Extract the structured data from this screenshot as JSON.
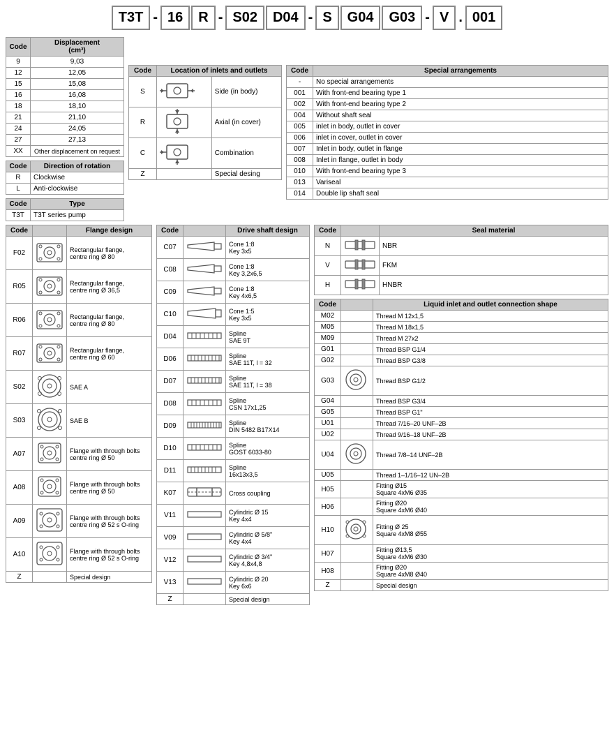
{
  "header": {
    "segments": [
      "T3T",
      "16",
      "R",
      "S02",
      "D04",
      "S",
      "G04",
      "G03",
      "V",
      "001"
    ],
    "dashes": [
      "-",
      "-",
      "-",
      "",
      "-",
      "",
      "",
      "-",
      ".",
      ""
    ],
    "display": "T3T - 16 R - S02 D04 - S G04 G03 - V . 001"
  },
  "displacement_table": {
    "title": "Displacement (cm³)",
    "col1": "Code",
    "col2": "Displacement (cm³)",
    "rows": [
      {
        "code": "9",
        "value": "9,03"
      },
      {
        "code": "12",
        "value": "12,05"
      },
      {
        "code": "15",
        "value": "15,08"
      },
      {
        "code": "16",
        "value": "16,08"
      },
      {
        "code": "18",
        "value": "18,10"
      },
      {
        "code": "21",
        "value": "21,10"
      },
      {
        "code": "24",
        "value": "24,05"
      },
      {
        "code": "27",
        "value": "27,13"
      },
      {
        "code": "XX",
        "value": "Other displacement on request"
      }
    ]
  },
  "rotation_table": {
    "col1": "Code",
    "col2": "Direction of rotation",
    "rows": [
      {
        "code": "R",
        "value": "Clockwise"
      },
      {
        "code": "L",
        "value": "Anti-clockwise"
      }
    ]
  },
  "type_table": {
    "col1": "Code",
    "col2": "Type",
    "rows": [
      {
        "code": "T3T",
        "value": "T3T series pump"
      }
    ]
  },
  "inlets_table": {
    "col1": "Code",
    "col2": "Location of inlets and outlets",
    "rows": [
      {
        "code": "S",
        "label": "Side (in body)"
      },
      {
        "code": "R",
        "label": "Axial (in cover)"
      },
      {
        "code": "C",
        "label": "Combination"
      },
      {
        "code": "Z",
        "label": "Special desing"
      }
    ]
  },
  "special_table": {
    "col1": "Code",
    "col2": "Special arrangements",
    "rows": [
      {
        "code": "-",
        "value": "No special arrangements"
      },
      {
        "code": "001",
        "value": "With front-end bearing type 1"
      },
      {
        "code": "002",
        "value": "With front-end bearing type 2"
      },
      {
        "code": "004",
        "value": "Without shaft seal"
      },
      {
        "code": "005",
        "value": "inlet in body, outlet in cover"
      },
      {
        "code": "006",
        "value": "inlet in cover, outlet in cover"
      },
      {
        "code": "007",
        "value": "Inlet in body, outlet in flange"
      },
      {
        "code": "008",
        "value": "Inlet in flange, outlet in body"
      },
      {
        "code": "010",
        "value": "With front-end bearing type 3"
      },
      {
        "code": "013",
        "value": "Variseal"
      },
      {
        "code": "014",
        "value": "Double lip shaft seal"
      }
    ]
  },
  "drive_shaft_table": {
    "col1": "Code",
    "col2": "Drive shaft design",
    "rows": [
      {
        "code": "C07",
        "label": "Cone 1:8\nKey 3x5"
      },
      {
        "code": "C08",
        "label": "Cone 1:8\nKey 3,2x6,5"
      },
      {
        "code": "C09",
        "label": "Cone 1:8\nKey 4x6,5"
      },
      {
        "code": "C10",
        "label": "Cone 1:5\nKey 3x5"
      },
      {
        "code": "D04",
        "label": "Spline\nSAE 9T"
      },
      {
        "code": "D06",
        "label": "Spline\nSAE 11T, l = 32"
      },
      {
        "code": "D07",
        "label": "Spline\nSAE 11T, l = 38"
      },
      {
        "code": "D08",
        "label": "Spline\nCSN 17x1,25"
      },
      {
        "code": "D09",
        "label": "Spline\nDIN 5482 B17X14"
      },
      {
        "code": "D10",
        "label": "Spline\nGOST 6033-80"
      },
      {
        "code": "D11",
        "label": "Spline\n16x13x3,5"
      },
      {
        "code": "K07",
        "label": "Cross coupling"
      },
      {
        "code": "V11",
        "label": "Cylindric Ø 15\nKey 4x4"
      },
      {
        "code": "V09",
        "label": "Cylindric  Ø 5/8''\nKey 4x4"
      },
      {
        "code": "V12",
        "label": "Cylindric  Ø 3/4''\nKey 4,8x4,8"
      },
      {
        "code": "V13",
        "label": "Cylindric Ø 20\nKey 6x6"
      },
      {
        "code": "Z",
        "label": "Special design"
      }
    ]
  },
  "seal_material_table": {
    "col1": "Code",
    "col2": "Seal material",
    "rows": [
      {
        "code": "N",
        "label": "NBR"
      },
      {
        "code": "V",
        "label": "FKM"
      },
      {
        "code": "H",
        "label": "HNBR"
      }
    ]
  },
  "flange_design_table": {
    "col1": "Code",
    "col2": "Flange design",
    "rows": [
      {
        "code": "F02",
        "label": "Rectangular flange,\ncentre ring Ø 80"
      },
      {
        "code": "R05",
        "label": "Rectangular flange,\ncentre ring Ø 36,5"
      },
      {
        "code": "R06",
        "label": "Rectangular flange,\ncentre ring Ø 80"
      },
      {
        "code": "R07",
        "label": "Rectangular flange,\ncentre ring Ø 60"
      },
      {
        "code": "S02",
        "label": "SAE A"
      },
      {
        "code": "S03",
        "label": "SAE B"
      },
      {
        "code": "A07",
        "label": "Flange with through bolts\ncentre ring Ø 50"
      },
      {
        "code": "A08",
        "label": "Flange with through bolts\ncentre ring Ø 50"
      },
      {
        "code": "A09",
        "label": "Flange with through bolts\ncentre ring Ø 52 s O-ring"
      },
      {
        "code": "A10",
        "label": "Flange with through bolts\ncentre ring Ø 52 s O-ring"
      },
      {
        "code": "Z",
        "label": "Special design"
      }
    ]
  },
  "liquid_connection_table": {
    "col1": "Code",
    "col2": "Liquid inlet and outlet connection shape",
    "rows": [
      {
        "code": "M02",
        "label": "Thread M 12x1,5"
      },
      {
        "code": "M05",
        "label": "Thread M 18x1,5"
      },
      {
        "code": "M09",
        "label": "Thread M 27x2"
      },
      {
        "code": "G01",
        "label": "Thread BSP G1/4"
      },
      {
        "code": "G02",
        "label": "Thread BSP G3/8"
      },
      {
        "code": "G03",
        "label": "Thread BSP G1/2"
      },
      {
        "code": "G04",
        "label": "Thread BSP G3/4"
      },
      {
        "code": "G05",
        "label": "Thread BSP G1\""
      },
      {
        "code": "U01",
        "label": "Thread 7/16–20 UNF–2B"
      },
      {
        "code": "U02",
        "label": "Thread 9/16–18 UNF–2B"
      },
      {
        "code": "U04",
        "label": "Thread 7/8–14 UNF–2B"
      },
      {
        "code": "U05",
        "label": "Thread 1–1/16–12 UN–2B"
      },
      {
        "code": "H05",
        "label": "Fitting Ø15\nSquare 4xM6 Ø35"
      },
      {
        "code": "H06",
        "label": "Fitting Ø20\nSquare 4xM6 Ø40"
      },
      {
        "code": "H10",
        "label": "Fitting Ø 25\nSquare 4xM8 Ø55"
      },
      {
        "code": "H07",
        "label": "Fitting Ø13,5\nSquare 4xM6 Ø30"
      },
      {
        "code": "H08",
        "label": "Fitting Ø20\nSquare 4xM8 Ø40"
      },
      {
        "code": "Z",
        "label": "Special design"
      }
    ]
  }
}
